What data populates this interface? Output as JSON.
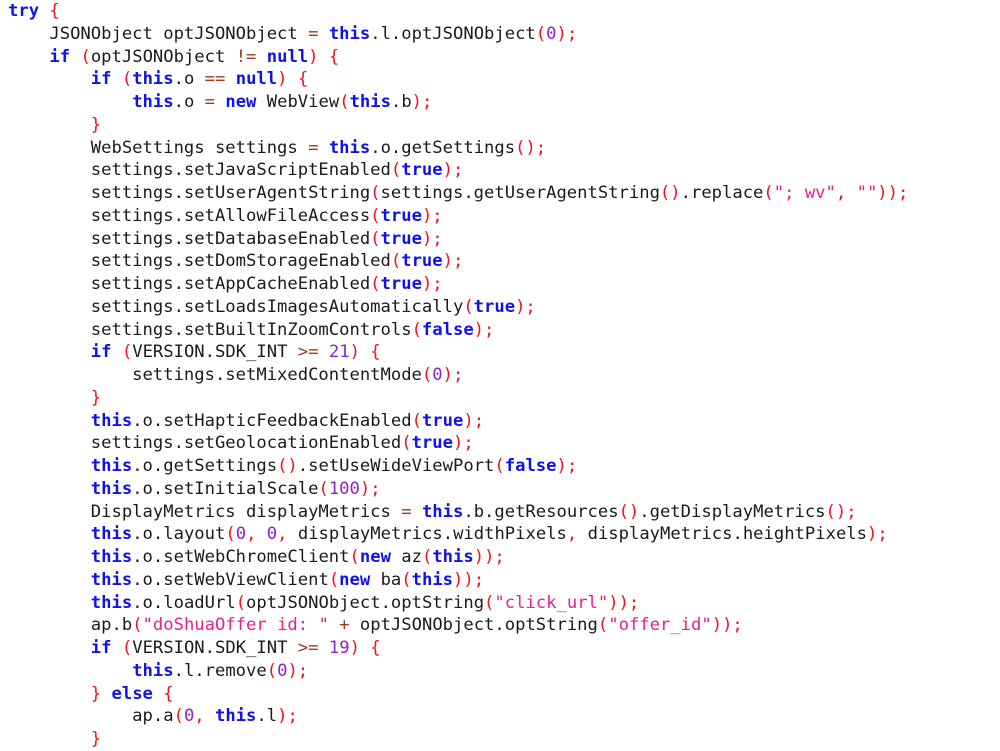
{
  "editor": {
    "language": "java",
    "background_color": "#ffffff",
    "default_text_color": "#1a1a1a",
    "font_size_px": 17,
    "line_height_px": 23,
    "indent_width_spaces": 4,
    "theme": {
      "keyword_color": "#1111ee",
      "punctuation_color": "#f01020",
      "operator_color": "#9a3a18",
      "number_color": "#8c23c4",
      "string_color": "#ea1f8d",
      "plain_color": "#1a1a1a"
    }
  },
  "code": {
    "lines": [
      [
        {
          "t": "keyword",
          "v": "try"
        },
        {
          "t": "plain",
          "v": " "
        },
        {
          "t": "punct",
          "v": "{"
        }
      ],
      [
        {
          "t": "plain",
          "v": "    JSONObject optJSONObject "
        },
        {
          "t": "operator",
          "v": "="
        },
        {
          "t": "plain",
          "v": " "
        },
        {
          "t": "keyword",
          "v": "this"
        },
        {
          "t": "plain",
          "v": ".l.optJSONObject"
        },
        {
          "t": "punct",
          "v": "("
        },
        {
          "t": "number",
          "v": "0"
        },
        {
          "t": "punct",
          "v": ");"
        }
      ],
      [
        {
          "t": "plain",
          "v": "    "
        },
        {
          "t": "keyword",
          "v": "if"
        },
        {
          "t": "plain",
          "v": " "
        },
        {
          "t": "punct",
          "v": "("
        },
        {
          "t": "plain",
          "v": "optJSONObject "
        },
        {
          "t": "operator",
          "v": "!="
        },
        {
          "t": "plain",
          "v": " "
        },
        {
          "t": "keyword",
          "v": "null"
        },
        {
          "t": "punct",
          "v": ")"
        },
        {
          "t": "plain",
          "v": " "
        },
        {
          "t": "punct",
          "v": "{"
        }
      ],
      [
        {
          "t": "plain",
          "v": "        "
        },
        {
          "t": "keyword",
          "v": "if"
        },
        {
          "t": "plain",
          "v": " "
        },
        {
          "t": "punct",
          "v": "("
        },
        {
          "t": "keyword",
          "v": "this"
        },
        {
          "t": "plain",
          "v": ".o "
        },
        {
          "t": "operator",
          "v": "=="
        },
        {
          "t": "plain",
          "v": " "
        },
        {
          "t": "keyword",
          "v": "null"
        },
        {
          "t": "punct",
          "v": ")"
        },
        {
          "t": "plain",
          "v": " "
        },
        {
          "t": "punct",
          "v": "{"
        }
      ],
      [
        {
          "t": "plain",
          "v": "            "
        },
        {
          "t": "keyword",
          "v": "this"
        },
        {
          "t": "plain",
          "v": ".o "
        },
        {
          "t": "operator",
          "v": "="
        },
        {
          "t": "plain",
          "v": " "
        },
        {
          "t": "keyword",
          "v": "new"
        },
        {
          "t": "plain",
          "v": " WebView"
        },
        {
          "t": "punct",
          "v": "("
        },
        {
          "t": "keyword",
          "v": "this"
        },
        {
          "t": "plain",
          "v": ".b"
        },
        {
          "t": "punct",
          "v": ");"
        }
      ],
      [
        {
          "t": "plain",
          "v": "        "
        },
        {
          "t": "punct",
          "v": "}"
        }
      ],
      [
        {
          "t": "plain",
          "v": "        WebSettings settings "
        },
        {
          "t": "operator",
          "v": "="
        },
        {
          "t": "plain",
          "v": " "
        },
        {
          "t": "keyword",
          "v": "this"
        },
        {
          "t": "plain",
          "v": ".o.getSettings"
        },
        {
          "t": "punct",
          "v": "();"
        }
      ],
      [
        {
          "t": "plain",
          "v": "        settings.setJavaScriptEnabled"
        },
        {
          "t": "punct",
          "v": "("
        },
        {
          "t": "keyword",
          "v": "true"
        },
        {
          "t": "punct",
          "v": ");"
        }
      ],
      [
        {
          "t": "plain",
          "v": "        settings.setUserAgentString"
        },
        {
          "t": "punct",
          "v": "("
        },
        {
          "t": "plain",
          "v": "settings.getUserAgentString"
        },
        {
          "t": "punct",
          "v": "()"
        },
        {
          "t": "plain",
          "v": ".replace"
        },
        {
          "t": "punct",
          "v": "("
        },
        {
          "t": "string",
          "v": "\"; wv\""
        },
        {
          "t": "punct",
          "v": ","
        },
        {
          "t": "plain",
          "v": " "
        },
        {
          "t": "string",
          "v": "\"\""
        },
        {
          "t": "punct",
          "v": "));"
        }
      ],
      [
        {
          "t": "plain",
          "v": "        settings.setAllowFileAccess"
        },
        {
          "t": "punct",
          "v": "("
        },
        {
          "t": "keyword",
          "v": "true"
        },
        {
          "t": "punct",
          "v": ");"
        }
      ],
      [
        {
          "t": "plain",
          "v": "        settings.setDatabaseEnabled"
        },
        {
          "t": "punct",
          "v": "("
        },
        {
          "t": "keyword",
          "v": "true"
        },
        {
          "t": "punct",
          "v": ");"
        }
      ],
      [
        {
          "t": "plain",
          "v": "        settings.setDomStorageEnabled"
        },
        {
          "t": "punct",
          "v": "("
        },
        {
          "t": "keyword",
          "v": "true"
        },
        {
          "t": "punct",
          "v": ");"
        }
      ],
      [
        {
          "t": "plain",
          "v": "        settings.setAppCacheEnabled"
        },
        {
          "t": "punct",
          "v": "("
        },
        {
          "t": "keyword",
          "v": "true"
        },
        {
          "t": "punct",
          "v": ");"
        }
      ],
      [
        {
          "t": "plain",
          "v": "        settings.setLoadsImagesAutomatically"
        },
        {
          "t": "punct",
          "v": "("
        },
        {
          "t": "keyword",
          "v": "true"
        },
        {
          "t": "punct",
          "v": ");"
        }
      ],
      [
        {
          "t": "plain",
          "v": "        settings.setBuiltInZoomControls"
        },
        {
          "t": "punct",
          "v": "("
        },
        {
          "t": "keyword",
          "v": "false"
        },
        {
          "t": "punct",
          "v": ");"
        }
      ],
      [
        {
          "t": "plain",
          "v": "        "
        },
        {
          "t": "keyword",
          "v": "if"
        },
        {
          "t": "plain",
          "v": " "
        },
        {
          "t": "punct",
          "v": "("
        },
        {
          "t": "plain",
          "v": "VERSION.SDK_INT "
        },
        {
          "t": "operator",
          "v": ">="
        },
        {
          "t": "plain",
          "v": " "
        },
        {
          "t": "number",
          "v": "21"
        },
        {
          "t": "punct",
          "v": ")"
        },
        {
          "t": "plain",
          "v": " "
        },
        {
          "t": "punct",
          "v": "{"
        }
      ],
      [
        {
          "t": "plain",
          "v": "            settings.setMixedContentMode"
        },
        {
          "t": "punct",
          "v": "("
        },
        {
          "t": "number",
          "v": "0"
        },
        {
          "t": "punct",
          "v": ");"
        }
      ],
      [
        {
          "t": "plain",
          "v": "        "
        },
        {
          "t": "punct",
          "v": "}"
        }
      ],
      [
        {
          "t": "plain",
          "v": "        "
        },
        {
          "t": "keyword",
          "v": "this"
        },
        {
          "t": "plain",
          "v": ".o.setHapticFeedbackEnabled"
        },
        {
          "t": "punct",
          "v": "("
        },
        {
          "t": "keyword",
          "v": "true"
        },
        {
          "t": "punct",
          "v": ");"
        }
      ],
      [
        {
          "t": "plain",
          "v": "        settings.setGeolocationEnabled"
        },
        {
          "t": "punct",
          "v": "("
        },
        {
          "t": "keyword",
          "v": "true"
        },
        {
          "t": "punct",
          "v": ");"
        }
      ],
      [
        {
          "t": "plain",
          "v": "        "
        },
        {
          "t": "keyword",
          "v": "this"
        },
        {
          "t": "plain",
          "v": ".o.getSettings"
        },
        {
          "t": "punct",
          "v": "()"
        },
        {
          "t": "plain",
          "v": ".setUseWideViewPort"
        },
        {
          "t": "punct",
          "v": "("
        },
        {
          "t": "keyword",
          "v": "false"
        },
        {
          "t": "punct",
          "v": ");"
        }
      ],
      [
        {
          "t": "plain",
          "v": "        "
        },
        {
          "t": "keyword",
          "v": "this"
        },
        {
          "t": "plain",
          "v": ".o.setInitialScale"
        },
        {
          "t": "punct",
          "v": "("
        },
        {
          "t": "number",
          "v": "100"
        },
        {
          "t": "punct",
          "v": ");"
        }
      ],
      [
        {
          "t": "plain",
          "v": "        DisplayMetrics displayMetrics "
        },
        {
          "t": "operator",
          "v": "="
        },
        {
          "t": "plain",
          "v": " "
        },
        {
          "t": "keyword",
          "v": "this"
        },
        {
          "t": "plain",
          "v": ".b.getResources"
        },
        {
          "t": "punct",
          "v": "()"
        },
        {
          "t": "plain",
          "v": ".getDisplayMetrics"
        },
        {
          "t": "punct",
          "v": "();"
        }
      ],
      [
        {
          "t": "plain",
          "v": "        "
        },
        {
          "t": "keyword",
          "v": "this"
        },
        {
          "t": "plain",
          "v": ".o.layout"
        },
        {
          "t": "punct",
          "v": "("
        },
        {
          "t": "number",
          "v": "0"
        },
        {
          "t": "punct",
          "v": ","
        },
        {
          "t": "plain",
          "v": " "
        },
        {
          "t": "number",
          "v": "0"
        },
        {
          "t": "punct",
          "v": ","
        },
        {
          "t": "plain",
          "v": " displayMetrics.widthPixels"
        },
        {
          "t": "punct",
          "v": ","
        },
        {
          "t": "plain",
          "v": " displayMetrics.heightPixels"
        },
        {
          "t": "punct",
          "v": ");"
        }
      ],
      [
        {
          "t": "plain",
          "v": "        "
        },
        {
          "t": "keyword",
          "v": "this"
        },
        {
          "t": "plain",
          "v": ".o.setWebChromeClient"
        },
        {
          "t": "punct",
          "v": "("
        },
        {
          "t": "keyword",
          "v": "new"
        },
        {
          "t": "plain",
          "v": " az"
        },
        {
          "t": "punct",
          "v": "("
        },
        {
          "t": "keyword",
          "v": "this"
        },
        {
          "t": "punct",
          "v": "));"
        }
      ],
      [
        {
          "t": "plain",
          "v": "        "
        },
        {
          "t": "keyword",
          "v": "this"
        },
        {
          "t": "plain",
          "v": ".o.setWebViewClient"
        },
        {
          "t": "punct",
          "v": "("
        },
        {
          "t": "keyword",
          "v": "new"
        },
        {
          "t": "plain",
          "v": " ba"
        },
        {
          "t": "punct",
          "v": "("
        },
        {
          "t": "keyword",
          "v": "this"
        },
        {
          "t": "punct",
          "v": "));"
        }
      ],
      [
        {
          "t": "plain",
          "v": "        "
        },
        {
          "t": "keyword",
          "v": "this"
        },
        {
          "t": "plain",
          "v": ".o.loadUrl"
        },
        {
          "t": "punct",
          "v": "("
        },
        {
          "t": "plain",
          "v": "optJSONObject.optString"
        },
        {
          "t": "punct",
          "v": "("
        },
        {
          "t": "string",
          "v": "\"click_url\""
        },
        {
          "t": "punct",
          "v": "));"
        }
      ],
      [
        {
          "t": "plain",
          "v": "        ap.b"
        },
        {
          "t": "punct",
          "v": "("
        },
        {
          "t": "string",
          "v": "\"doShuaOffer id: \""
        },
        {
          "t": "plain",
          "v": " "
        },
        {
          "t": "operator",
          "v": "+"
        },
        {
          "t": "plain",
          "v": " optJSONObject.optString"
        },
        {
          "t": "punct",
          "v": "("
        },
        {
          "t": "string",
          "v": "\"offer_id\""
        },
        {
          "t": "punct",
          "v": "));"
        }
      ],
      [
        {
          "t": "plain",
          "v": "        "
        },
        {
          "t": "keyword",
          "v": "if"
        },
        {
          "t": "plain",
          "v": " "
        },
        {
          "t": "punct",
          "v": "("
        },
        {
          "t": "plain",
          "v": "VERSION.SDK_INT "
        },
        {
          "t": "operator",
          "v": ">="
        },
        {
          "t": "plain",
          "v": " "
        },
        {
          "t": "number",
          "v": "19"
        },
        {
          "t": "punct",
          "v": ")"
        },
        {
          "t": "plain",
          "v": " "
        },
        {
          "t": "punct",
          "v": "{"
        }
      ],
      [
        {
          "t": "plain",
          "v": "            "
        },
        {
          "t": "keyword",
          "v": "this"
        },
        {
          "t": "plain",
          "v": ".l.remove"
        },
        {
          "t": "punct",
          "v": "("
        },
        {
          "t": "number",
          "v": "0"
        },
        {
          "t": "punct",
          "v": ");"
        }
      ],
      [
        {
          "t": "plain",
          "v": "        "
        },
        {
          "t": "punct",
          "v": "}"
        },
        {
          "t": "plain",
          "v": " "
        },
        {
          "t": "keyword",
          "v": "else"
        },
        {
          "t": "plain",
          "v": " "
        },
        {
          "t": "punct",
          "v": "{"
        }
      ],
      [
        {
          "t": "plain",
          "v": "            ap.a"
        },
        {
          "t": "punct",
          "v": "("
        },
        {
          "t": "number",
          "v": "0"
        },
        {
          "t": "punct",
          "v": ","
        },
        {
          "t": "plain",
          "v": " "
        },
        {
          "t": "keyword",
          "v": "this"
        },
        {
          "t": "plain",
          "v": ".l"
        },
        {
          "t": "punct",
          "v": ");"
        }
      ],
      [
        {
          "t": "plain",
          "v": "        "
        },
        {
          "t": "punct",
          "v": "}"
        }
      ]
    ]
  }
}
